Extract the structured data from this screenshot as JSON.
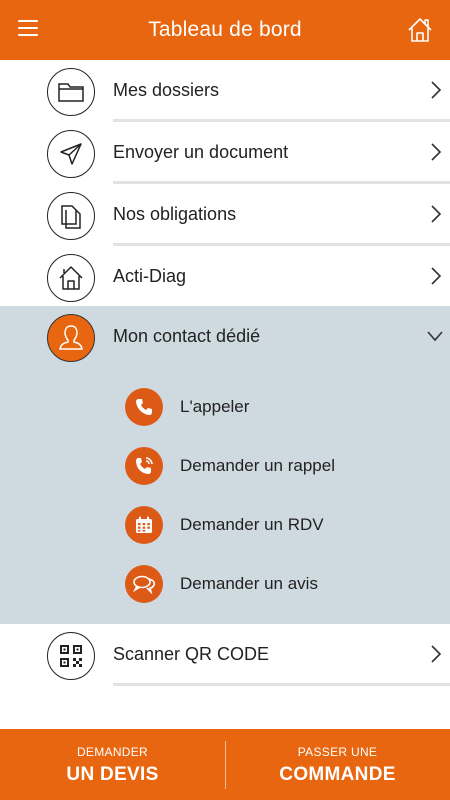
{
  "header": {
    "title": "Tableau de bord",
    "menu_icon": "hamburger-menu-icon",
    "home_icon": "home-icon"
  },
  "menu": {
    "items": [
      {
        "label": "Mes dossiers",
        "icon": "folder-icon"
      },
      {
        "label": "Envoyer un document",
        "icon": "send-icon"
      },
      {
        "label": "Nos obligations",
        "icon": "documents-icon"
      },
      {
        "label": "Acti-Diag",
        "icon": "house-icon"
      }
    ],
    "contact": {
      "label": "Mon contact dédié",
      "icon": "person-icon",
      "expanded": true,
      "actions": [
        {
          "label": "L'appeler",
          "icon": "phone-icon"
        },
        {
          "label": "Demander un rappel",
          "icon": "phone-callback-icon"
        },
        {
          "label": "Demander un RDV",
          "icon": "calendar-icon"
        },
        {
          "label": "Demander un avis",
          "icon": "chat-bubbles-icon"
        }
      ]
    },
    "scanner": {
      "label": "Scanner QR CODE",
      "icon": "qr-code-icon"
    }
  },
  "bottom_bar": {
    "devis": {
      "small": "DEMANDER",
      "big": "UN DEVIS"
    },
    "commande": {
      "small": "PASSER UNE",
      "big": "COMMANDE"
    }
  },
  "colors": {
    "accent": "#e8660f",
    "expanded_background": "#cfd9e0",
    "divider": "#e2e2e2"
  }
}
